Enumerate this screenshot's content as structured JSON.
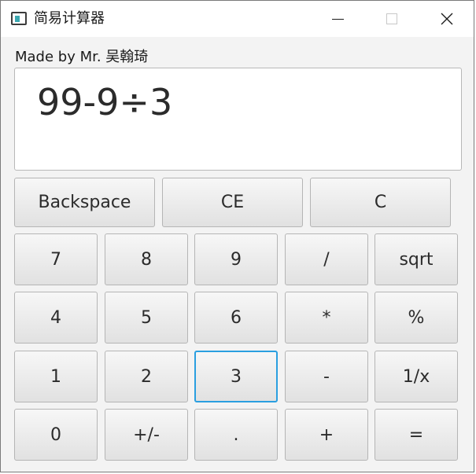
{
  "window": {
    "title": "简易计算器"
  },
  "credit": "Made by Mr. 吴翰琦",
  "display": {
    "expression": "99-9÷3"
  },
  "buttons": {
    "backspace": "Backspace",
    "ce": "CE",
    "c": "C",
    "seven": "7",
    "eight": "8",
    "nine": "9",
    "divide": "/",
    "sqrt": "sqrt",
    "four": "4",
    "five": "5",
    "six": "6",
    "multiply": "*",
    "percent": "%",
    "one": "1",
    "two": "2",
    "three": "3",
    "minus": "-",
    "reciprocal": "1/x",
    "zero": "0",
    "negate": "+/-",
    "decimal": ".",
    "plus": "+",
    "equals": "="
  },
  "colors": {
    "focus_border": "#2a9fe0",
    "button_top": "#f7f7f7",
    "button_bottom": "#e1e1e1",
    "window_bg": "#f3f3f3"
  },
  "focused_button": "three"
}
